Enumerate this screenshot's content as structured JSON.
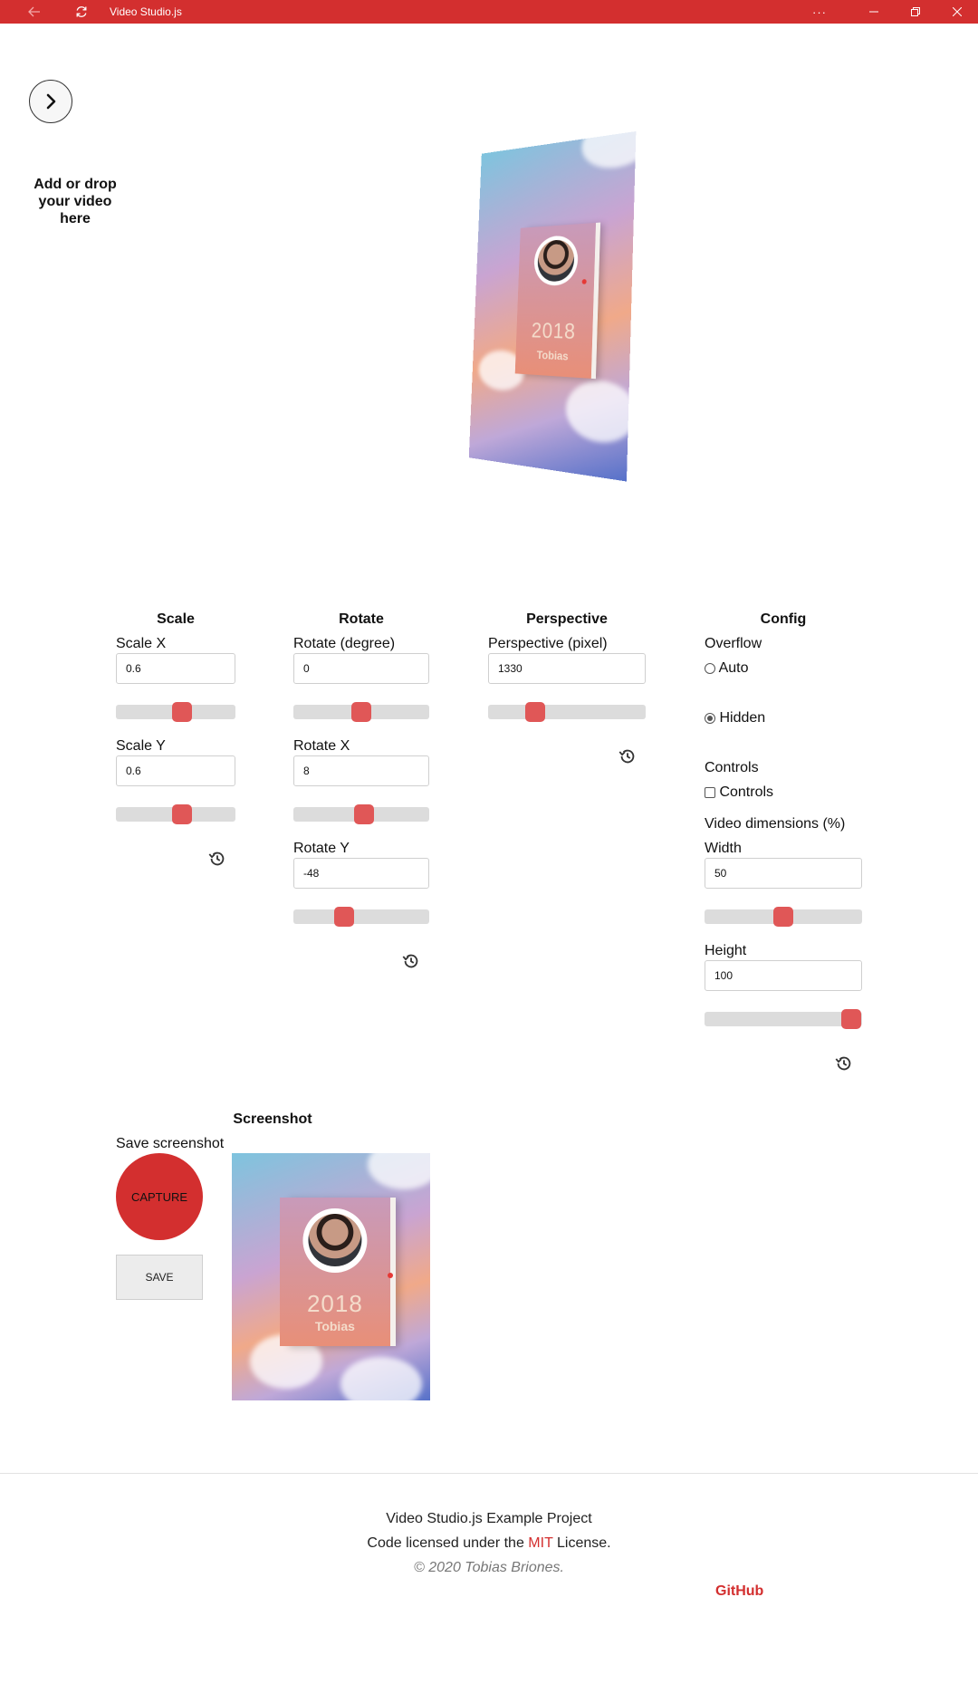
{
  "window": {
    "title": "Video Studio.js",
    "more_label": "···",
    "accent": "#d32f2f"
  },
  "sidebar": {
    "drop_text": "Add or drop your video here"
  },
  "scale": {
    "title": "Scale",
    "x_label": "Scale X",
    "x_value": "0.6",
    "y_label": "Scale Y",
    "y_value": "0.6"
  },
  "rotate": {
    "title": "Rotate",
    "deg_label": "Rotate (degree)",
    "deg_value": "0",
    "x_label": "Rotate X",
    "x_value": "8",
    "y_label": "Rotate Y",
    "y_value": "-48"
  },
  "perspective": {
    "title": "Perspective",
    "label": "Perspective (pixel)",
    "value": "1330"
  },
  "config": {
    "title": "Config",
    "overflow_label": "Overflow",
    "overflow_auto": "Auto",
    "overflow_hidden": "Hidden",
    "controls_label": "Controls",
    "controls_checkbox": "Controls",
    "dimensions_label": "Video dimensions (%)",
    "width_label": "Width",
    "width_value": "50",
    "height_label": "Height",
    "height_value": "100"
  },
  "sliders": {
    "scale_x": 0.55,
    "scale_y": 0.55,
    "rotate_deg": 0.5,
    "rotate_x": 0.52,
    "rotate_y": 0.37,
    "perspective": 0.3,
    "width": 0.5,
    "height": 0.93
  },
  "screenshot": {
    "title": "Screenshot",
    "save_label": "Save screenshot",
    "capture_button": "CAPTURE",
    "save_button": "SAVE"
  },
  "video": {
    "year": "2018",
    "name": "Tobias"
  },
  "footer": {
    "line1": "Video Studio.js Example Project",
    "line2_prefix": "Code licensed under the",
    "line2_link": "MIT",
    "line2_suffix": "License.",
    "copyright": "© 2020 Tobias Briones.",
    "github": "GitHub"
  }
}
